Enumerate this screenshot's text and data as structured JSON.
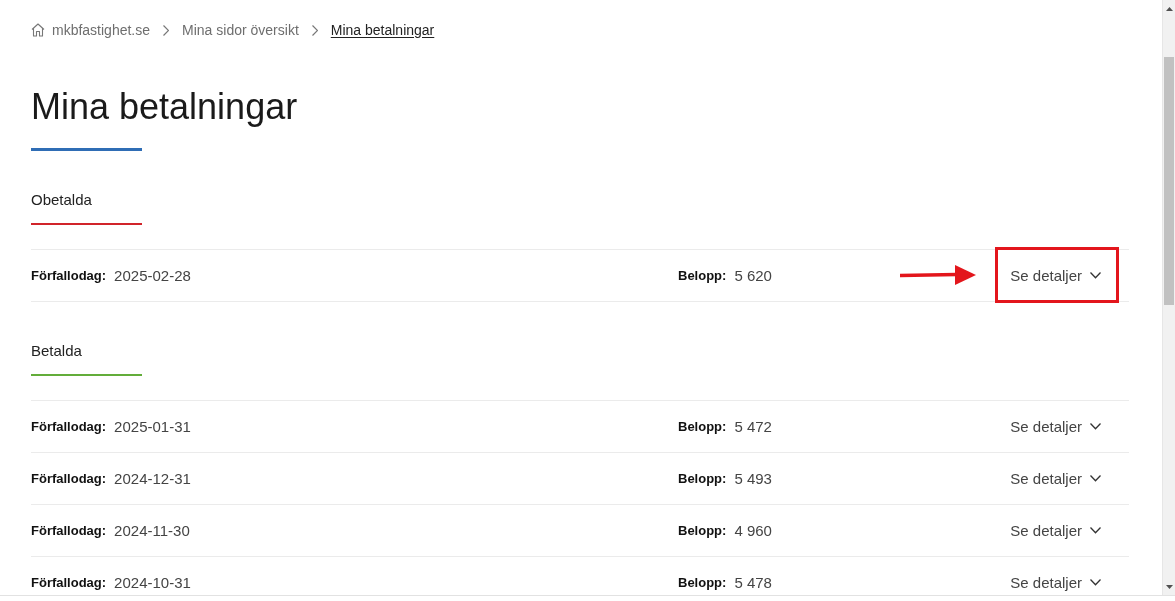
{
  "breadcrumb": [
    {
      "label": "mkbfastighet.se",
      "kind": "home"
    },
    {
      "label": "Mina sidor översikt",
      "kind": "link"
    },
    {
      "label": "Mina betalningar",
      "kind": "current"
    }
  ],
  "heading": "Mina betalningar",
  "sections": [
    {
      "title": "Obetalda",
      "color": "#d1242a",
      "rows": [
        {
          "due_label": "Förfallodag:",
          "due_date": "2025-02-28",
          "amount_label": "Belopp:",
          "amount": "5 620",
          "action": "Se detaljer",
          "expanded": false,
          "highlighted": true
        }
      ]
    },
    {
      "title": "Betalda",
      "color": "#63ad3a",
      "rows": [
        {
          "due_label": "Förfallodag:",
          "due_date": "2025-01-31",
          "amount_label": "Belopp:",
          "amount": "5 472",
          "action": "Se detaljer",
          "expanded": false,
          "highlighted": false
        },
        {
          "due_label": "Förfallodag:",
          "due_date": "2024-12-31",
          "amount_label": "Belopp:",
          "amount": "5 493",
          "action": "Se detaljer",
          "expanded": false,
          "highlighted": false
        },
        {
          "due_label": "Förfallodag:",
          "due_date": "2024-11-30",
          "amount_label": "Belopp:",
          "amount": "4 960",
          "action": "Se detaljer",
          "expanded": false,
          "highlighted": false
        },
        {
          "due_label": "Förfallodag:",
          "due_date": "2024-10-31",
          "amount_label": "Belopp:",
          "amount": "5 478",
          "action": "Se detaljer",
          "expanded": false,
          "highlighted": false
        }
      ]
    }
  ]
}
